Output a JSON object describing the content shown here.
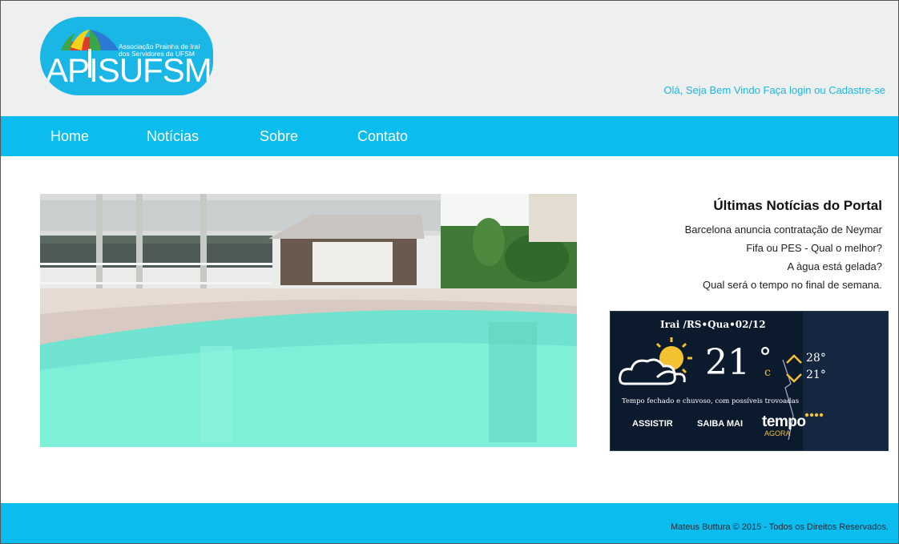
{
  "logo": {
    "association_line1": "Associação Prainha de Iraí",
    "association_line2": "dos Servidores da UFSM",
    "brand": "APISUFSM"
  },
  "header": {
    "greeting": "Olá, Seja Bem Vindo",
    "login": "Faça login",
    "or": "ou",
    "signup": "Cadastre-se"
  },
  "nav": {
    "items": [
      {
        "label": "Home"
      },
      {
        "label": "Notícias"
      },
      {
        "label": "Sobre"
      },
      {
        "label": "Contato"
      }
    ]
  },
  "news": {
    "title": "Últimas Notícias do Portal",
    "items": [
      {
        "label": "Barcelona anuncia contratação de Neymar"
      },
      {
        "label": "Fifa ou PES - Qual o melhor?"
      },
      {
        "label": "A àgua está gelada?"
      },
      {
        "label": "Qual será o tempo no final de semana."
      }
    ]
  },
  "weather": {
    "location": "Irai /RS•Qua•02/12",
    "temperature": "21",
    "degree_symbol": "°",
    "unit": "c",
    "high": "28°",
    "low": "21°",
    "description": "Tempo fechado e chuvoso, com possíveis trovoadas",
    "watch_button": "ASSISTIR",
    "more_button": "SAIBA MAI",
    "brand": "tempo",
    "brand_sub": "AGORA"
  },
  "footer": {
    "copyright": "Mateus Buttura © 2015 - Todos os Direitos Reservados."
  },
  "colors": {
    "accent": "#0bbcee",
    "header_bg": "#eef0ef",
    "logo_bg": "#1ab6e6",
    "weather_bg": "#0c1a2e",
    "weather_yellow": "#f2c230"
  }
}
